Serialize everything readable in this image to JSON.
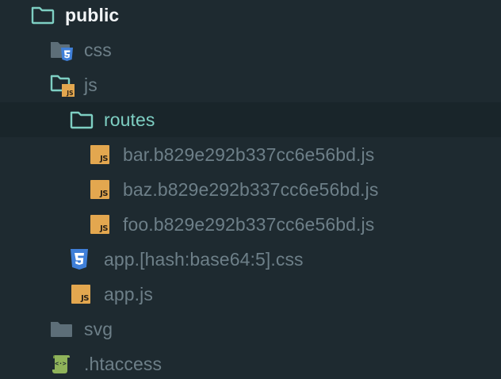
{
  "tree": {
    "items": [
      {
        "label": "public",
        "kind": "folder-open",
        "icon": "folder-open-icon"
      },
      {
        "label": "css",
        "kind": "folder",
        "icon": "folder-css-icon"
      },
      {
        "label": "js",
        "kind": "folder-open",
        "icon": "folder-js-icon"
      },
      {
        "label": "routes",
        "kind": "folder-open",
        "icon": "folder-open-icon",
        "selected": true
      },
      {
        "label": "bar.b829e292b337cc6e56bd.js",
        "kind": "file",
        "icon": "js-file-icon"
      },
      {
        "label": "baz.b829e292b337cc6e56bd.js",
        "kind": "file",
        "icon": "js-file-icon"
      },
      {
        "label": "foo.b829e292b337cc6e56bd.js",
        "kind": "file",
        "icon": "js-file-icon"
      },
      {
        "label": "app.[hash:base64:5].css",
        "kind": "file",
        "icon": "css-file-icon"
      },
      {
        "label": "app.js",
        "kind": "file",
        "icon": "js-file-icon"
      },
      {
        "label": "svg",
        "kind": "folder",
        "icon": "folder-icon"
      },
      {
        "label": ".htaccess",
        "kind": "file",
        "icon": "htaccess-file-icon"
      }
    ],
    "js_badge_text": "JS"
  },
  "colors": {
    "background": "#1e2a30",
    "selected_row": "#19252a",
    "text_muted": "#6d7f88",
    "text_folder_open": "#7ecfc3",
    "text_root": "#f1f4f6",
    "js_badge": "#e3a74f",
    "css_badge": "#3f7fd8",
    "folder_teal": "#7ecfc3",
    "folder_gray": "#5d6e78",
    "htaccess_green": "#8fb35a"
  }
}
